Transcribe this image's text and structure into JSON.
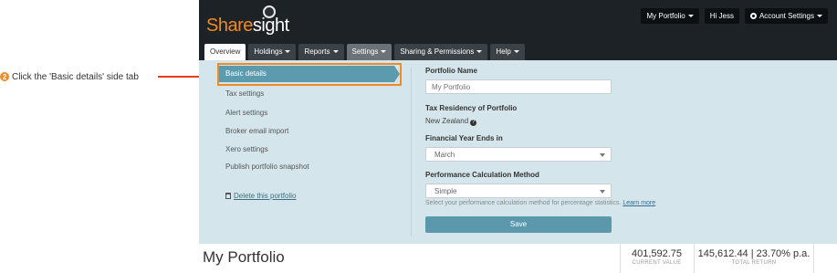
{
  "annotation": {
    "step_number": "2",
    "text": "Click the 'Basic details' side tab"
  },
  "header": {
    "logo_primary": "Share",
    "logo_secondary": "sight",
    "portfolio_button": "My Portfolio",
    "greeting_button": "Hi Jess",
    "account_button": "Account Settings",
    "tabs": [
      {
        "label": "Overview"
      },
      {
        "label": "Holdings"
      },
      {
        "label": "Reports"
      },
      {
        "label": "Settings"
      },
      {
        "label": "Sharing & Permissions"
      },
      {
        "label": "Help"
      }
    ]
  },
  "sidebar": {
    "items": [
      {
        "label": "Basic details"
      },
      {
        "label": "Tax settings"
      },
      {
        "label": "Alert settings"
      },
      {
        "label": "Broker email import"
      },
      {
        "label": "Xero settings"
      },
      {
        "label": "Publish portfolio snapshot"
      },
      {
        "label": "Delete this portfolio"
      }
    ]
  },
  "form": {
    "portfolio_name_label": "Portfolio Name",
    "portfolio_name_value": "My Portfolio",
    "tax_residency_label": "Tax Residency of Portfolio",
    "tax_residency_value": "New Zealand",
    "fy_label": "Financial Year Ends in",
    "fy_value": "March",
    "perf_label": "Performance Calculation Method",
    "perf_value": "Simple",
    "perf_help": "Select your performance calculation method for percentage statistics.",
    "learn_more": "Learn more",
    "save_label": "Save"
  },
  "summary": {
    "title": "My Portfolio",
    "current_value": "401,592.75",
    "current_value_label": "CURRENT VALUE",
    "total_return": "145,612.44 | 23.70% p.a.",
    "total_return_label": "TOTAL RETURN"
  },
  "colors": {
    "header_bg": "#1d2226",
    "brand_orange": "#f08a24",
    "panel_bg": "#d4e6ec",
    "accent_teal": "#5b98ac"
  }
}
